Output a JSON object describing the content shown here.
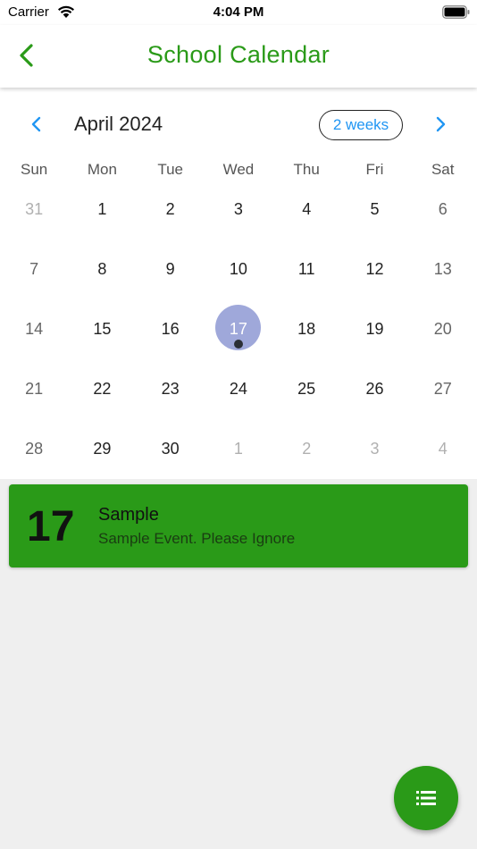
{
  "status_bar": {
    "carrier": "Carrier",
    "time": "4:04 PM"
  },
  "header": {
    "title": "School Calendar",
    "back_icon": "chevron-left-icon"
  },
  "calendar": {
    "month_label": "April 2024",
    "format_button": "2 weeks",
    "weekdays": [
      "Sun",
      "Mon",
      "Tue",
      "Wed",
      "Thu",
      "Fri",
      "Sat"
    ],
    "weeks": [
      [
        "31",
        "1",
        "2",
        "3",
        "4",
        "5",
        "6"
      ],
      [
        "7",
        "8",
        "9",
        "10",
        "11",
        "12",
        "13"
      ],
      [
        "14",
        "15",
        "16",
        "17",
        "18",
        "19",
        "20"
      ],
      [
        "21",
        "22",
        "23",
        "24",
        "25",
        "26",
        "27"
      ],
      [
        "28",
        "29",
        "30",
        "1",
        "2",
        "3",
        "4"
      ]
    ],
    "selected_day": "17",
    "event_marker_day": "17"
  },
  "event": {
    "day": "17",
    "title": "Sample",
    "description": "Sample Event. Please Ignore"
  },
  "fab": {
    "icon": "list-icon"
  },
  "colors": {
    "accent_green": "#2a9a18",
    "nav_blue": "#2196f3",
    "selected_circle": "#9fa8da",
    "background": "#efefef"
  }
}
